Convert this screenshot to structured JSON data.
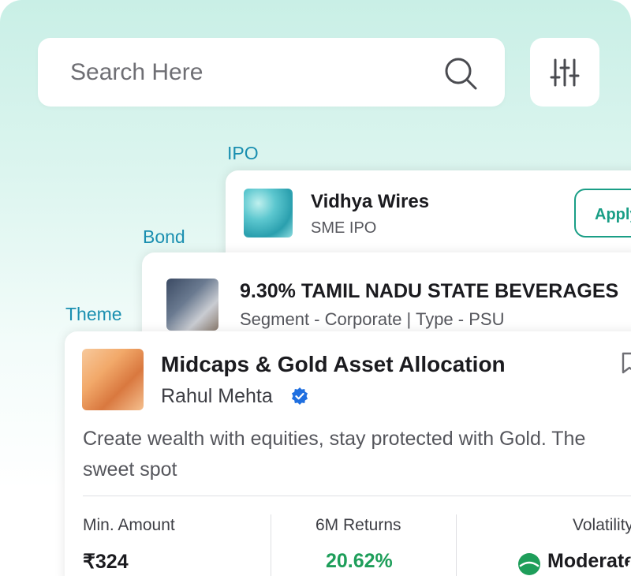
{
  "search": {
    "placeholder": "Search Here"
  },
  "categories": {
    "ipo": "IPO",
    "bond": "Bond",
    "theme": "Theme"
  },
  "ipo_card": {
    "title": "Vidhya Wires",
    "subtitle": "SME IPO",
    "button": "Apply"
  },
  "bond_card": {
    "title": "9.30% TAMIL NADU STATE BEVERAGES",
    "subtitle": "Segment - Corporate | Type - PSU"
  },
  "theme_card": {
    "title": "Midcaps & Gold Asset Allocation",
    "author": "Rahul Mehta",
    "description": "Create wealth with equities, stay protected with Gold. The sweet spot",
    "stats": {
      "min_amount_label": "Min. Amount",
      "min_amount_value": "₹324",
      "returns_label": "6M Returns",
      "returns_value": "20.62%",
      "volatility_label": "Volatility",
      "volatility_value": "Moderate"
    }
  },
  "colors": {
    "accent": "#1a9e86",
    "category_label": "#1a8fb0",
    "returns_positive": "#1e9e5a",
    "verified": "#1f6fe0"
  },
  "icons": [
    "search-icon",
    "filter-sliders-icon",
    "verified-badge-icon",
    "bookmark-icon",
    "volatility-gauge-icon"
  ]
}
